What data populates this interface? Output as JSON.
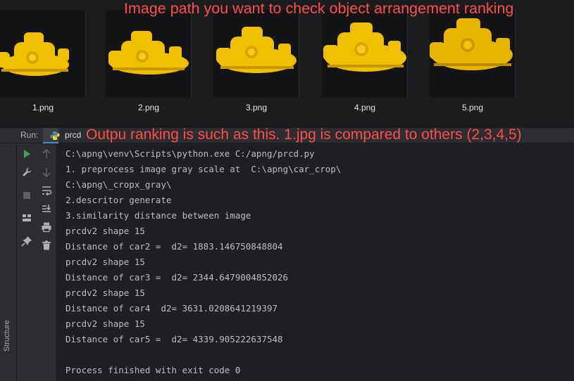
{
  "annotations": {
    "top": "Image path you want to check object arrangement ranking",
    "run": "Outpu ranking is such as this. 1.jpg is compared to others (2,3,4,5)"
  },
  "thumbnails": [
    {
      "label": "1.png"
    },
    {
      "label": "2.png"
    },
    {
      "label": "3.png"
    },
    {
      "label": "4.png"
    },
    {
      "label": "5.png"
    }
  ],
  "run_window": {
    "run_label": "Run:",
    "tab_name": "prcd",
    "side_label": "Structure"
  },
  "console": {
    "lines": [
      "C:\\apng\\venv\\Scripts\\python.exe C:/apng/prcd.py",
      "1. preprocess image gray scale at  C:\\apng\\car_crop\\",
      "C:\\apng\\_cropx_gray\\",
      "2.descritor generate",
      "3.similarity distance between image",
      "prcdv2 shape 15",
      "Distance of car2 =  d2= 1883.146750848804",
      "prcdv2 shape 15",
      "Distance of car3 =  d2= 2344.6479004852026",
      "prcdv2 shape 15",
      "Distance of car4  d2= 3631.0208641219397",
      "prcdv2 shape 15",
      "Distance of car5 =  d2= 4339.905222637548",
      "",
      "Process finished with exit code 0"
    ]
  },
  "colors": {
    "annotation": "#ff4d4d",
    "toy_yellow": "#f2c200",
    "run_green": "#499c54"
  }
}
